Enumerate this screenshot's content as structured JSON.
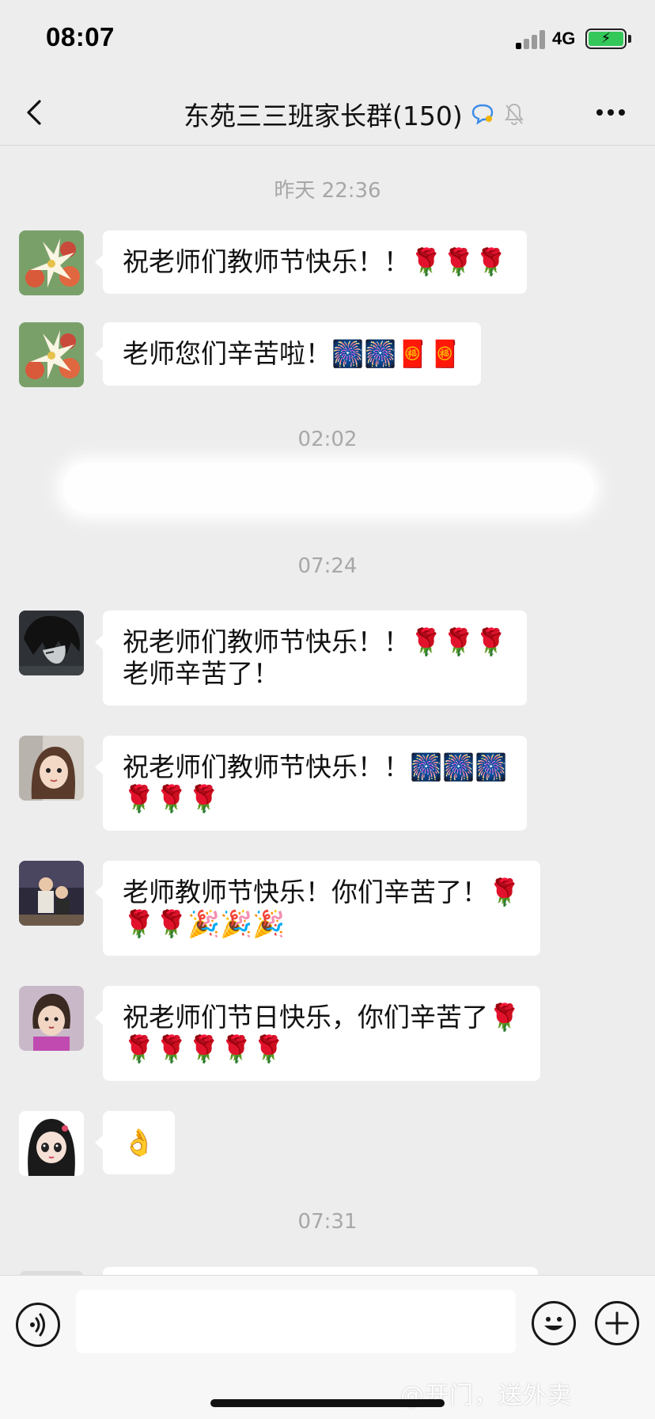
{
  "status_bar": {
    "time": "08:07",
    "network": "4G",
    "battery_color": "#34c759"
  },
  "nav": {
    "back_icon": "chevron-left-icon",
    "title": "东苑三三班家长群(150)",
    "more_icon": "ellipsis-icon"
  },
  "messages": {
    "timestamps": [
      "昨天 22:36",
      "02:02",
      "07:24",
      "07:31"
    ],
    "items": [
      {
        "line1": "祝老师们教师节快乐！！🌹🌹🌹"
      },
      {
        "line1": "老师您们辛苦啦！🎆🎆🧧🧧"
      },
      {
        "line1": "祝老师们教师节快乐！！🌹🌹🌹",
        "line2": "老师辛苦了！"
      },
      {
        "line1": "祝老师们教师节快乐！！🎆🎆🎆",
        "line2": "🌹🌹🌹"
      },
      {
        "line1": "老师教师节快乐！你们辛苦了！🌹",
        "line2": "🌹🌹🎉🎉🎉"
      },
      {
        "line1": "祝老师们节日快乐，你们辛苦了🌹",
        "line2": "🌹🌹🌹🌹🌹"
      },
      {
        "line1": "👌"
      }
    ]
  },
  "input_bar": {
    "watermark": "@开门，送外卖"
  }
}
